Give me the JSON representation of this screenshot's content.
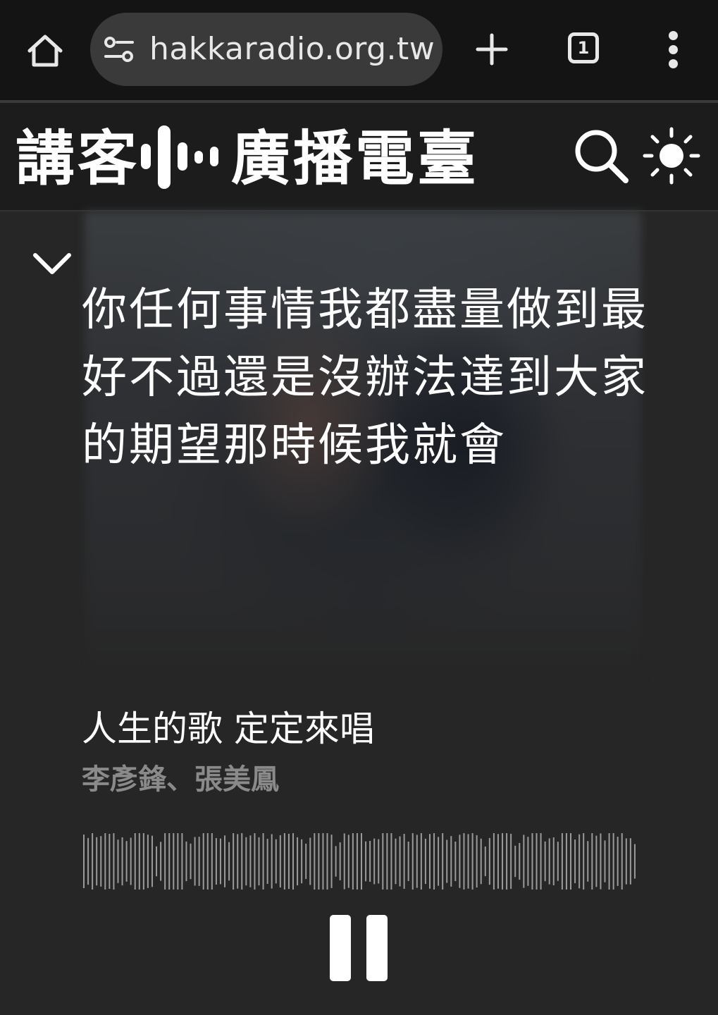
{
  "browser": {
    "url": "hakkaradio.org.tw",
    "tab_count": "1",
    "icons": [
      "home-icon",
      "tune-icon",
      "plus-icon",
      "tabs-icon",
      "more-vert-icon"
    ]
  },
  "site": {
    "logo_chars": [
      "講",
      "客",
      "廣",
      "播",
      "電",
      "臺"
    ],
    "icons": [
      "search-icon",
      "sun-icon"
    ]
  },
  "player": {
    "lyrics": [
      "你任何事情我都盡量做到最",
      "好不過還是沒辦法達到大家",
      "的期望那時候我就會"
    ],
    "title": "人生的歌 定定來唱",
    "artist": "李彥鋒、張美鳳",
    "state": "playing",
    "icons": [
      "chevron-down-icon",
      "waveform",
      "pause-icon"
    ]
  },
  "colors": {
    "browser_bg": "#141414",
    "header_bg": "#1c1c1c",
    "player_bg": "#262626",
    "text_primary": "#ffffff",
    "text_secondary": "#8a8a8a"
  }
}
